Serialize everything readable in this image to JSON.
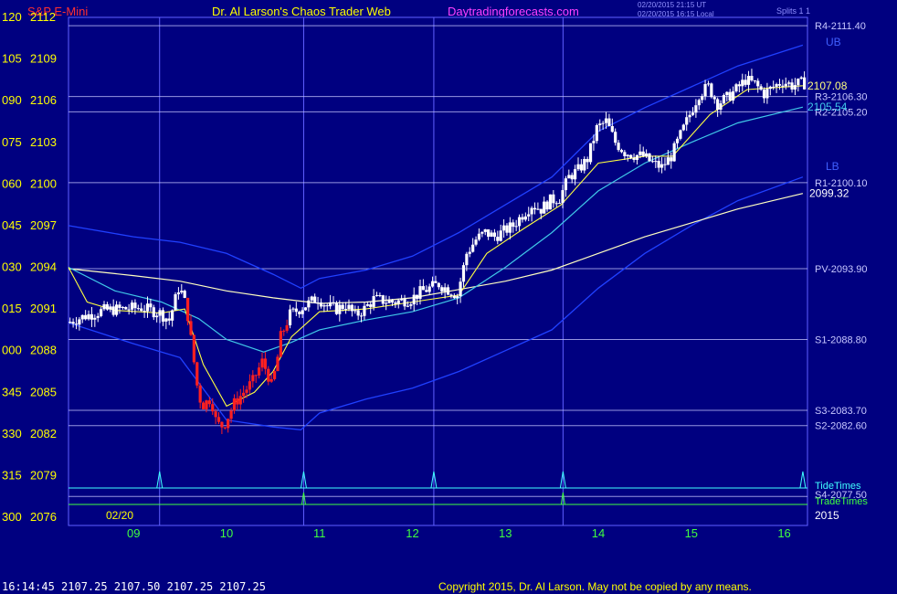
{
  "header": {
    "instrument": "S&P E-Mini",
    "site_title": "Dr. Al Larson's Chaos Trader Web",
    "site_url": "Daytradingforecasts.com",
    "timestamp_ut": "02/20/2015 21:15 UT",
    "timestamp_local": "02/20/2015 16:15 Local",
    "splits": "Splits 1 1"
  },
  "footer": {
    "quote": "16:14:45  2107.25 2107.50 2107.25 2107.25",
    "copyright": "Copyright 2015, Dr. Al Larson. May not be copied by any means."
  },
  "colors": {
    "background": "#000080",
    "grid": "#6060ff",
    "level_line": "#c8c8ff",
    "candle_up": "#ffffff",
    "candle_down": "#ff2020",
    "ema_fast": "#ffff40",
    "ema_mid": "#40c8e8",
    "ema_slow": "#ffffc0",
    "band": "#2040ff",
    "tide": "#40ffff",
    "trade": "#40ff40",
    "y_label_left": "#ffff00",
    "y_label_right": "#ffffff",
    "x_label": "#40ff40"
  },
  "chart_data": {
    "type": "candlestick",
    "date_label": "02/20",
    "year_label": "2015",
    "x_ticks": [
      "09",
      "10",
      "11",
      "12",
      "13",
      "14",
      "15",
      "16"
    ],
    "y_range": [
      2076,
      2112
    ],
    "y_ticks": [
      {
        "left": "120",
        "price": 2112
      },
      {
        "left": "105",
        "price": 2109
      },
      {
        "left": "090",
        "price": 2106
      },
      {
        "left": "075",
        "price": 2103
      },
      {
        "left": "060",
        "price": 2100
      },
      {
        "left": "045",
        "price": 2097
      },
      {
        "left": "030",
        "price": 2094
      },
      {
        "left": "015",
        "price": 2091
      },
      {
        "left": "000",
        "price": 2088
      },
      {
        "left": "345",
        "price": 2085
      },
      {
        "left": "330",
        "price": 2082
      },
      {
        "left": "315",
        "price": 2079
      },
      {
        "left": "300",
        "price": 2076
      }
    ],
    "levels": [
      {
        "label": "R4-2111.40",
        "price": 2111.4
      },
      {
        "label": "R3-2106.30",
        "price": 2106.3
      },
      {
        "label": "R2-2105.20",
        "price": 2105.2
      },
      {
        "label": "R1-2100.10",
        "price": 2100.1
      },
      {
        "label": "PV-2093.90",
        "price": 2093.9
      },
      {
        "label": "S1-2088.80",
        "price": 2088.8
      },
      {
        "label": "S3-2083.70",
        "price": 2083.7
      },
      {
        "label": "S2-2082.60",
        "price": 2082.6
      }
    ],
    "band_labels": {
      "upper": "UB",
      "lower": "LB"
    },
    "value_labels": [
      {
        "text": "2107.08",
        "price": 2107.08
      },
      {
        "text": "2105.54",
        "price": 2105.54
      },
      {
        "text": "2099.32",
        "price": 2099.32
      }
    ],
    "tide_label": "TideTimes",
    "trade_label": "TradeTimes",
    "s4_label": "S4-2077.50",
    "s4_price": 2077.5,
    "session_start_hour": 8.3,
    "session_end_hour": 16.25,
    "vertical_time_lines": [
      9.28,
      10.83,
      12.23,
      13.62
    ],
    "tide_times": [
      9.28,
      10.83,
      12.23,
      13.62,
      16.2
    ],
    "trade_times": [
      10.83,
      13.62
    ],
    "price_path": [
      [
        8.3,
        2090.0
      ],
      [
        8.5,
        2090.5
      ],
      [
        8.7,
        2090.9
      ],
      [
        8.9,
        2091.0
      ],
      [
        9.1,
        2091.1
      ],
      [
        9.3,
        2090.7
      ],
      [
        9.4,
        2090.2
      ],
      [
        9.45,
        2091.3
      ],
      [
        9.5,
        2092.5
      ],
      [
        9.55,
        2092.0
      ],
      [
        9.6,
        2090.5
      ],
      [
        9.65,
        2088.0
      ],
      [
        9.7,
        2085.5
      ],
      [
        9.75,
        2084.0
      ],
      [
        9.8,
        2084.3
      ],
      [
        9.85,
        2084.6
      ],
      [
        9.9,
        2083.0
      ],
      [
        9.95,
        2082.5
      ],
      [
        10.0,
        2082.8
      ],
      [
        10.1,
        2084.2
      ],
      [
        10.2,
        2085.0
      ],
      [
        10.3,
        2085.8
      ],
      [
        10.4,
        2087.2
      ],
      [
        10.45,
        2086.5
      ],
      [
        10.5,
        2085.5
      ],
      [
        10.55,
        2086.8
      ],
      [
        10.6,
        2089.0
      ],
      [
        10.7,
        2090.6
      ],
      [
        10.8,
        2091.0
      ],
      [
        10.9,
        2091.4
      ],
      [
        11.0,
        2091.8
      ],
      [
        11.1,
        2091.2
      ],
      [
        11.2,
        2091.0
      ],
      [
        11.3,
        2091.3
      ],
      [
        11.4,
        2090.5
      ],
      [
        11.5,
        2091.0
      ],
      [
        11.6,
        2091.7
      ],
      [
        11.8,
        2091.5
      ],
      [
        12.0,
        2091.7
      ],
      [
        12.1,
        2092.2
      ],
      [
        12.3,
        2092.8
      ],
      [
        12.4,
        2092.4
      ],
      [
        12.5,
        2092.0
      ],
      [
        12.6,
        2095.0
      ],
      [
        12.7,
        2096.0
      ],
      [
        12.8,
        2096.5
      ],
      [
        12.9,
        2096.2
      ],
      [
        13.0,
        2096.6
      ],
      [
        13.1,
        2097.0
      ],
      [
        13.2,
        2097.8
      ],
      [
        13.3,
        2098.5
      ],
      [
        13.4,
        2098.2
      ],
      [
        13.5,
        2098.8
      ],
      [
        13.6,
        2099.0
      ],
      [
        13.7,
        2100.5
      ],
      [
        13.8,
        2101.0
      ],
      [
        13.9,
        2101.8
      ],
      [
        14.0,
        2104.0
      ],
      [
        14.1,
        2104.5
      ],
      [
        14.2,
        2103.0
      ],
      [
        14.3,
        2102.3
      ],
      [
        14.4,
        2102.1
      ],
      [
        14.5,
        2102.0
      ],
      [
        14.6,
        2101.5
      ],
      [
        14.7,
        2101.2
      ],
      [
        14.8,
        2102.0
      ],
      [
        14.9,
        2103.5
      ],
      [
        15.0,
        2105.0
      ],
      [
        15.1,
        2106.5
      ],
      [
        15.2,
        2107.0
      ],
      [
        15.3,
        2105.8
      ],
      [
        15.4,
        2106.2
      ],
      [
        15.5,
        2106.8
      ],
      [
        15.6,
        2107.5
      ],
      [
        15.7,
        2107.2
      ],
      [
        15.8,
        2106.5
      ],
      [
        15.9,
        2107.0
      ],
      [
        16.0,
        2107.4
      ],
      [
        16.1,
        2107.1
      ],
      [
        16.2,
        2107.25
      ]
    ],
    "ema_fast": [
      [
        8.3,
        2094.0
      ],
      [
        8.5,
        2091.5
      ],
      [
        8.8,
        2090.9
      ],
      [
        9.3,
        2090.7
      ],
      [
        9.55,
        2091.0
      ],
      [
        9.75,
        2087.0
      ],
      [
        10.0,
        2084.0
      ],
      [
        10.3,
        2085.0
      ],
      [
        10.5,
        2086.5
      ],
      [
        10.7,
        2089.0
      ],
      [
        11.0,
        2090.8
      ],
      [
        11.5,
        2091.0
      ],
      [
        12.0,
        2091.5
      ],
      [
        12.5,
        2092.0
      ],
      [
        12.8,
        2095.0
      ],
      [
        13.2,
        2096.8
      ],
      [
        13.6,
        2098.5
      ],
      [
        14.0,
        2101.5
      ],
      [
        14.5,
        2102.0
      ],
      [
        14.8,
        2102.0
      ],
      [
        15.2,
        2105.0
      ],
      [
        15.6,
        2106.8
      ],
      [
        16.2,
        2107.08
      ]
    ],
    "ema_mid": [
      [
        8.3,
        2094.0
      ],
      [
        8.8,
        2092.3
      ],
      [
        9.3,
        2091.5
      ],
      [
        9.7,
        2090.3
      ],
      [
        10.0,
        2088.8
      ],
      [
        10.4,
        2087.9
      ],
      [
        10.7,
        2088.6
      ],
      [
        11.0,
        2089.5
      ],
      [
        11.5,
        2090.2
      ],
      [
        12.0,
        2090.8
      ],
      [
        12.5,
        2091.8
      ],
      [
        13.0,
        2094.0
      ],
      [
        13.5,
        2096.5
      ],
      [
        14.0,
        2099.5
      ],
      [
        14.5,
        2101.5
      ],
      [
        15.0,
        2103.0
      ],
      [
        15.5,
        2104.4
      ],
      [
        16.2,
        2105.54
      ]
    ],
    "ema_slow": [
      [
        8.3,
        2093.9
      ],
      [
        9.0,
        2093.4
      ],
      [
        9.5,
        2093.0
      ],
      [
        10.0,
        2092.3
      ],
      [
        10.5,
        2091.8
      ],
      [
        11.0,
        2091.4
      ],
      [
        11.5,
        2091.5
      ],
      [
        12.0,
        2091.8
      ],
      [
        12.5,
        2092.4
      ],
      [
        13.0,
        2093.0
      ],
      [
        13.5,
        2093.8
      ],
      [
        14.0,
        2095.0
      ],
      [
        14.5,
        2096.2
      ],
      [
        15.0,
        2097.2
      ],
      [
        15.5,
        2098.2
      ],
      [
        16.2,
        2099.32
      ]
    ],
    "upper_band": [
      [
        8.3,
        2097.0
      ],
      [
        9.0,
        2096.2
      ],
      [
        9.5,
        2095.8
      ],
      [
        10.0,
        2095.0
      ],
      [
        10.5,
        2093.5
      ],
      [
        10.8,
        2092.5
      ],
      [
        11.0,
        2093.2
      ],
      [
        11.5,
        2093.8
      ],
      [
        12.0,
        2094.8
      ],
      [
        12.5,
        2096.5
      ],
      [
        13.0,
        2098.5
      ],
      [
        13.5,
        2100.5
      ],
      [
        14.0,
        2103.8
      ],
      [
        14.5,
        2105.5
      ],
      [
        15.0,
        2107.0
      ],
      [
        15.5,
        2108.5
      ],
      [
        16.2,
        2110.0
      ]
    ],
    "lower_band": [
      [
        8.3,
        2090.0
      ],
      [
        9.0,
        2088.5
      ],
      [
        9.5,
        2087.5
      ],
      [
        10.0,
        2083.0
      ],
      [
        10.5,
        2082.5
      ],
      [
        10.8,
        2082.3
      ],
      [
        11.0,
        2083.5
      ],
      [
        11.5,
        2084.5
      ],
      [
        12.0,
        2085.3
      ],
      [
        12.5,
        2086.5
      ],
      [
        13.0,
        2088.0
      ],
      [
        13.5,
        2089.5
      ],
      [
        14.0,
        2092.5
      ],
      [
        14.5,
        2095.0
      ],
      [
        15.0,
        2097.0
      ],
      [
        15.5,
        2098.8
      ],
      [
        16.2,
        2100.5
      ]
    ]
  }
}
